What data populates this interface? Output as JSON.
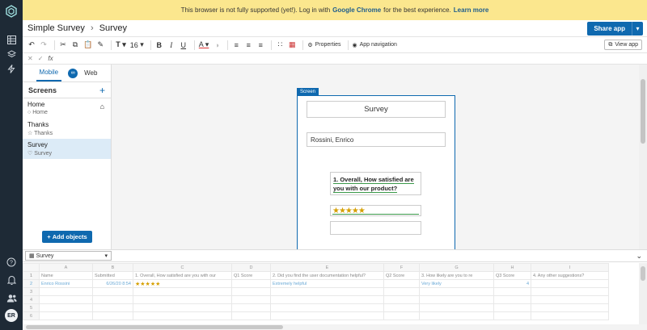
{
  "banner": {
    "text": "This browser is not fully supported (yet!). Log in with",
    "browser": "Google Chrome",
    "suffix": "for the best experience.",
    "learn_more": "Learn more"
  },
  "header": {
    "app": "Simple Survey",
    "screen": "Survey",
    "share": "Share app"
  },
  "toolbar": {
    "font_size": "16",
    "properties": "Properties",
    "app_navigation": "App navigation",
    "view_app": "View app"
  },
  "formula": {
    "fx": "fx"
  },
  "left_panel": {
    "tab_mobile": "Mobile",
    "tab_web": "Web",
    "screens_title": "Screens",
    "add_objects": "Add objects",
    "screens": [
      {
        "name": "Home",
        "sub": "Home"
      },
      {
        "name": "Thanks",
        "sub": "Thanks"
      },
      {
        "name": "Survey",
        "sub": "Survey"
      }
    ]
  },
  "phone": {
    "label": "Screen",
    "title": "Survey",
    "name_value": "Rossini, Enrico",
    "question_line1": "1. Overall, How satisfied are",
    "question_line2": "you with our product?",
    "stars": "★★★★★"
  },
  "grid": {
    "source": "Survey",
    "columns": [
      "A",
      "B",
      "C",
      "D",
      "E",
      "F",
      "G",
      "H",
      "I"
    ],
    "header_row": [
      "Name",
      "Submitted",
      "1. Overall, How satisfied are you with our",
      "Q1 Score",
      "2. Did you find the user documentation helpful?",
      "Q2 Score",
      "3. How likely are you to re",
      "Q3 Score",
      "4. Any other suggestions?"
    ],
    "row1": [
      "Enrico Rossini",
      "6/26/20 8:54",
      "★★★★★",
      "",
      "Extremely helpful",
      "",
      "Very likely",
      "4",
      ""
    ]
  },
  "rail": {
    "avatar": "ER"
  }
}
